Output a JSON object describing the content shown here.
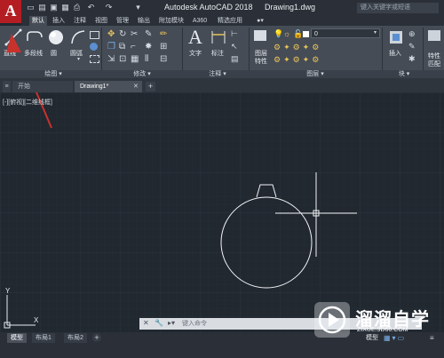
{
  "window": {
    "title": "Autodesk AutoCAD 2018",
    "file": "Drawing1.dwg",
    "search_placeholder": "键入关键字或短语",
    "app_letter": "A"
  },
  "ribbon_tabs": [
    "默认",
    "插入",
    "注释",
    "视图",
    "管理",
    "输出",
    "附加模块",
    "A360",
    "精选应用"
  ],
  "ribbon": {
    "draw": {
      "line": "直线",
      "polyline": "多段线",
      "circle": "圆",
      "arc": "圆弧"
    },
    "annotation": {
      "text": "文字",
      "dimension": "标注"
    },
    "layers": {
      "properties_line1": "图层",
      "properties_line2": "特性",
      "current_layer": "0"
    },
    "block": {
      "insert": "插入"
    },
    "properties": {
      "match_line1": "特性",
      "match_line2": "匹配"
    }
  },
  "panels": [
    "绘图 ▾",
    "修改 ▾",
    "注释 ▾",
    "图层 ▾",
    "块 ▾"
  ],
  "doc_tabs": [
    "开始",
    "Drawing1*"
  ],
  "viewport_label": "[-][俯视][二维线框]",
  "command_placeholder": "键入命令",
  "layout_tabs": [
    "模型",
    "布局1",
    "布局2"
  ],
  "status": {
    "model": "模型"
  },
  "watermark": {
    "title": "溜溜自学",
    "url": "ZIXUE.3D66.COM"
  },
  "colors": {
    "canvas": "#212830",
    "ribbon": "#454c56",
    "titlebar": "#2b3038",
    "annotation_red": "#c8322d",
    "app_red": "#b41d22"
  }
}
